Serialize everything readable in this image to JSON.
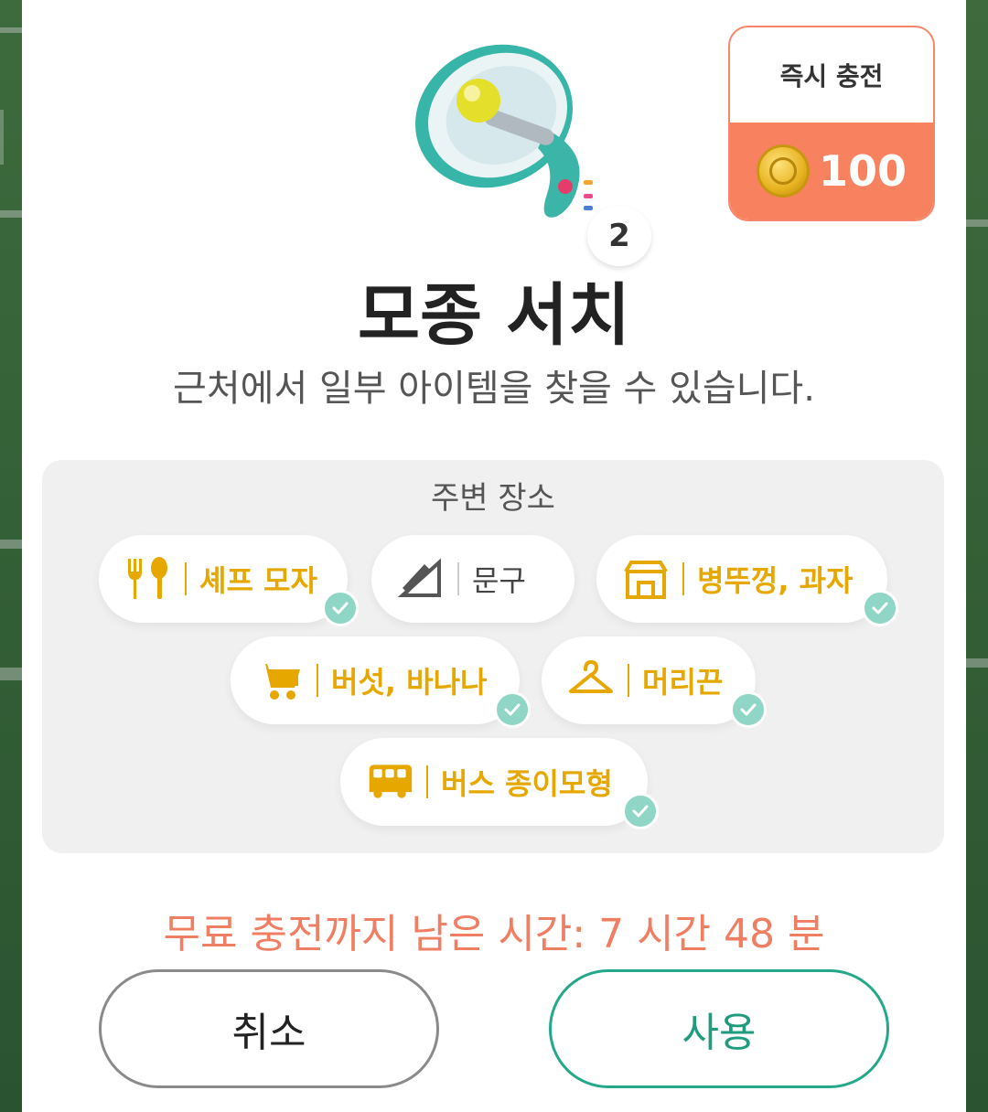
{
  "item": {
    "count": "2",
    "title": "모종 서치",
    "description": "근처에서 일부 아이템을 찾을 수 있습니다."
  },
  "instant_charge": {
    "label": "즉시 충전",
    "amount": "100",
    "icon": "coin-icon"
  },
  "nearby": {
    "title": "주변 장소",
    "places": [
      {
        "label": "셰프 모자",
        "icon": "fork-spoon-icon",
        "checked": true
      },
      {
        "label": "문구",
        "icon": "stationery-icon",
        "checked": false
      },
      {
        "label": "병뚜껑, 과자",
        "icon": "shop-icon",
        "checked": true
      },
      {
        "label": "버섯, 바나나",
        "icon": "cart-icon",
        "checked": true
      },
      {
        "label": "머리끈",
        "icon": "hanger-icon",
        "checked": true
      },
      {
        "label": "버스 종이모형",
        "icon": "bus-icon",
        "checked": true
      }
    ]
  },
  "timer": "무료 충전까지 남은 시간: 7 시간 48 분",
  "buttons": {
    "cancel": "취소",
    "use": "사용"
  },
  "colors": {
    "accent_orange": "#f8825f",
    "place_yellow": "#e6a700",
    "check_teal": "#8fd6c6",
    "use_green": "#1f9b7e"
  }
}
